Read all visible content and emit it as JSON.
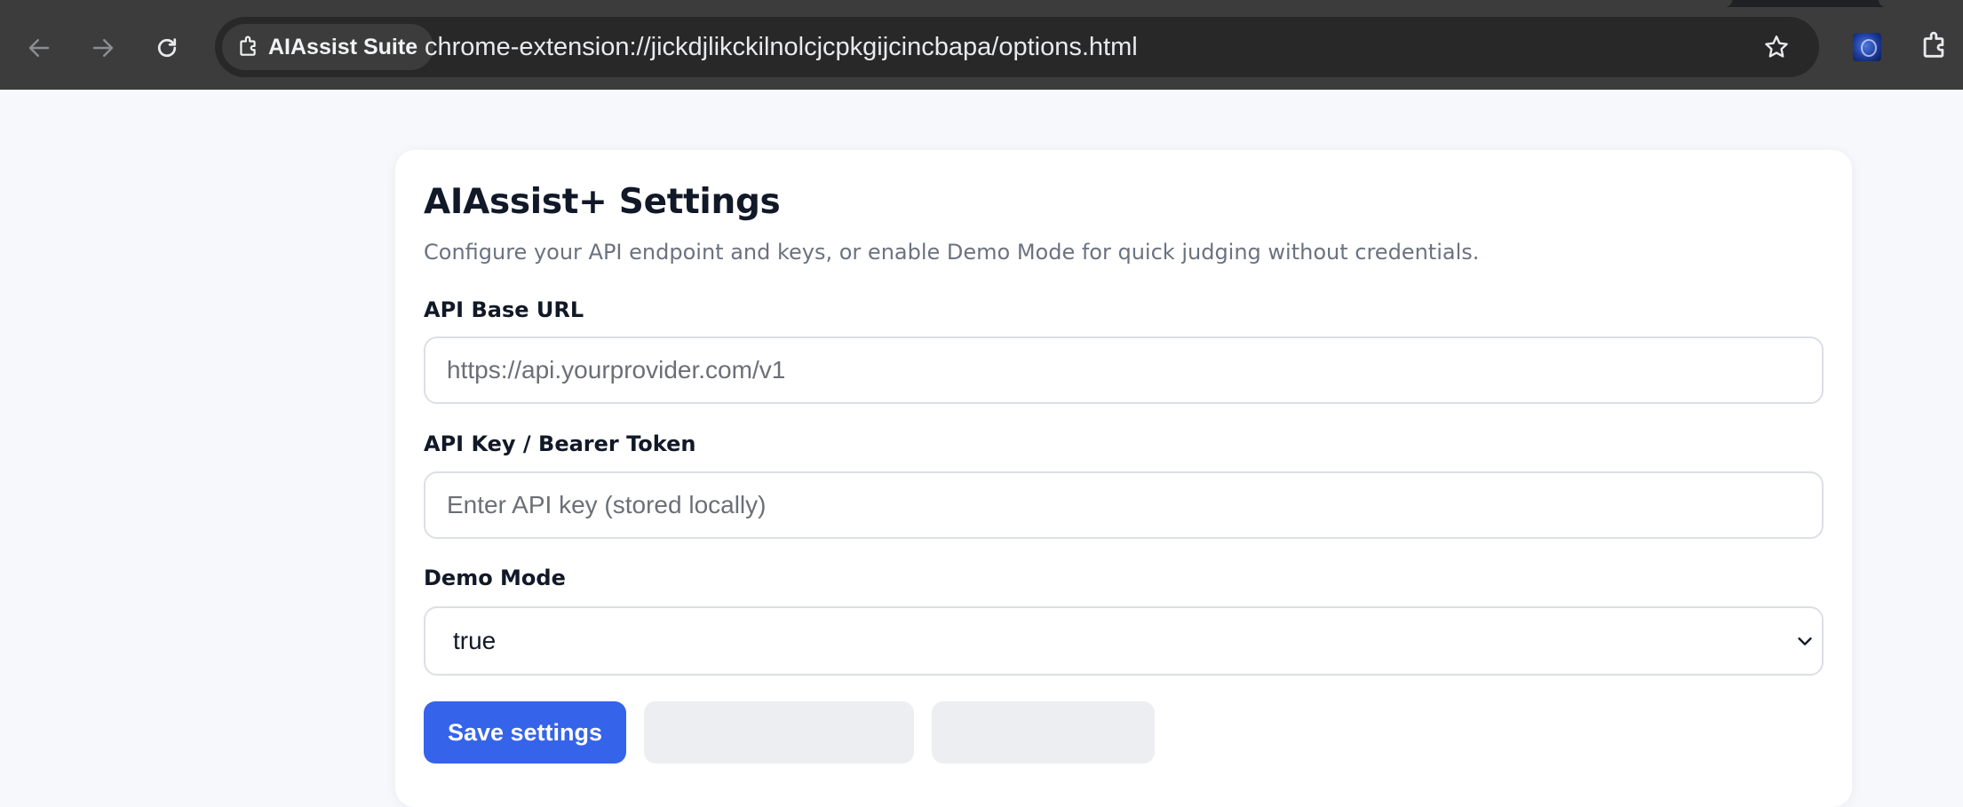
{
  "browser": {
    "site_chip_label": "AIAssist Suite",
    "url": "chrome-extension://jickdjlikckilnolcjcpkgijcincbapa/options.html",
    "icons": {
      "back": "arrow-left-icon",
      "forward": "arrow-right-icon",
      "reload": "reload-icon",
      "site": "puzzle-icon",
      "bookmark": "star-icon",
      "extension": "extension-avatar-icon",
      "extensions_menu": "puzzle-icon"
    },
    "colors": {
      "chrome_bg": "#3c3c3c",
      "omnibox_bg": "#282828"
    }
  },
  "settings": {
    "title": "AIAssist+ Settings",
    "subtitle": "Configure your API endpoint and keys, or enable Demo Mode for quick judging without credentials.",
    "api_base_url": {
      "label": "API Base URL",
      "value": "",
      "placeholder": "https://api.yourprovider.com/v1"
    },
    "api_key": {
      "label": "API Key / Bearer Token",
      "value": "",
      "placeholder": "Enter API key (stored locally)"
    },
    "demo_mode": {
      "label": "Demo Mode",
      "selected": "true"
    },
    "save_button_label": "Save settings",
    "colors": {
      "primary": "#3563e9",
      "page_bg": "#f7f8fb",
      "secondary_button": "#eceef1"
    }
  }
}
